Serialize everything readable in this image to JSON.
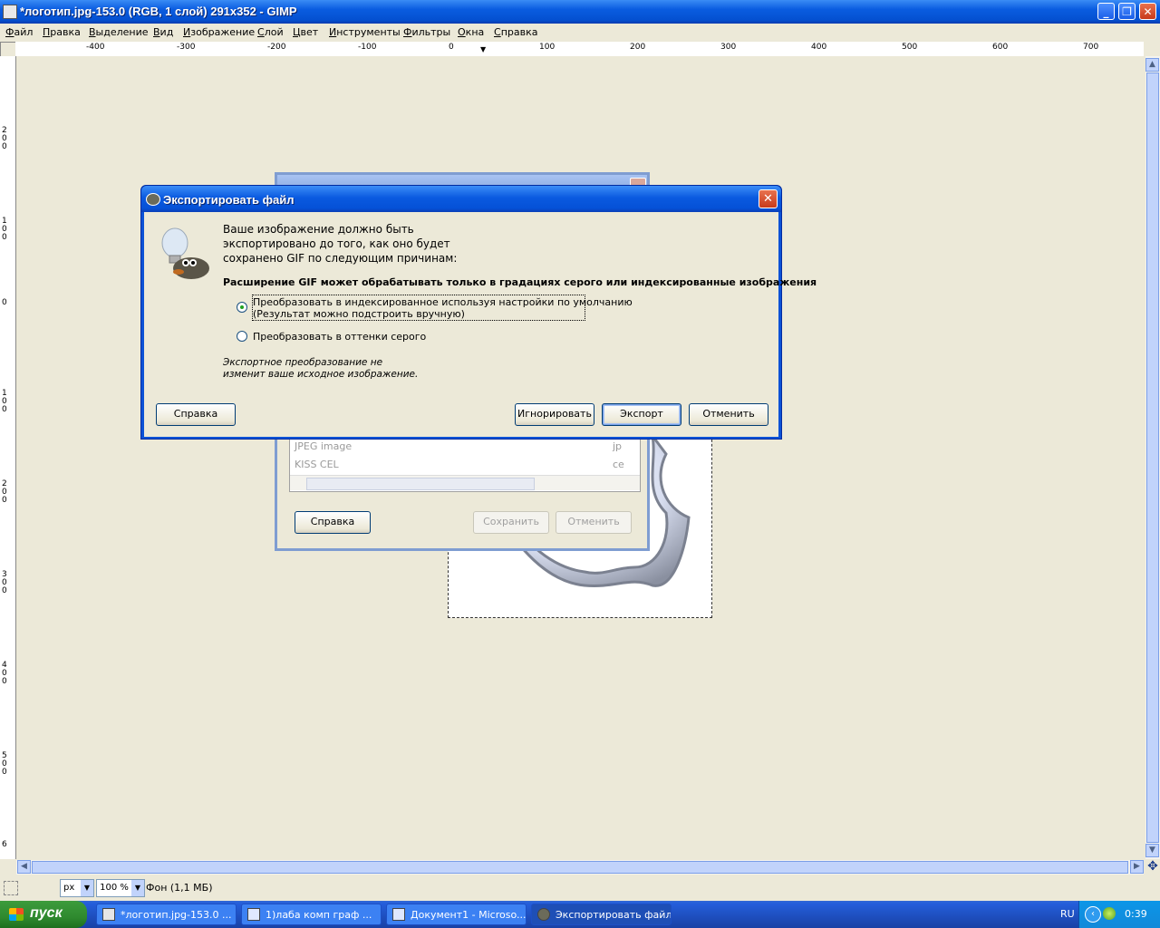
{
  "window": {
    "title": "*логотип.jpg-153.0 (RGB, 1 слой) 291x352 - GIMP",
    "buttons": {
      "minimize": "_",
      "maximize": "❐",
      "close": "✕"
    }
  },
  "menu": [
    "Файл",
    "Правка",
    "Выделение",
    "Вид",
    "Изображение",
    "Слой",
    "Цвет",
    "Инструменты",
    "Фильтры",
    "Окна",
    "Справка"
  ],
  "ruler": {
    "top_labels": [
      "-400",
      "-300",
      "-200",
      "-100",
      "0",
      "100",
      "200",
      "300",
      "400",
      "500",
      "600",
      "700"
    ],
    "left_labels": [
      "200",
      "100",
      "0",
      "100",
      "200",
      "300",
      "400",
      "500",
      "6"
    ]
  },
  "status": {
    "unit": "px",
    "zoom": "100 %",
    "layer_info": "Фон (1,1 МБ)"
  },
  "save_dialog": {
    "list_items": [
      {
        "name": "JPEG image",
        "ext": "jp"
      },
      {
        "name": "KISS CEL",
        "ext": "ce"
      }
    ],
    "help_label": "Справка",
    "save_label": "Сохранить",
    "cancel_label": "Отменить"
  },
  "export_dialog": {
    "title": "Экспортировать файл",
    "message_lines": [
      "Ваше изображение должно быть",
      "экспортировано до того, как оно будет",
      "сохранено GIF по следующим причинам:"
    ],
    "reason": "Расширение GIF может обрабатывать только в градациях серого или индексированные изображения",
    "option1_line1": "Преобразовать в индексированное используя настройки по умолчанию",
    "option1_line2": "(Результат можно подстроить вручную)",
    "option2": "Преобразовать в оттенки серого",
    "note_line1": "Экспортное преобразование не",
    "note_line2": "изменит ваше исходное изображение.",
    "help_label": "Справка",
    "ignore_label": "Игнорировать",
    "export_label": "Экспорт",
    "cancel_label": "Отменить",
    "selected_option": 1
  },
  "taskbar": {
    "start_label": "пуск",
    "tasks": [
      {
        "label": "*логотип.jpg-153.0 ...",
        "active": false
      },
      {
        "label": "1)лаба комп граф ...",
        "active": false
      },
      {
        "label": "Документ1 - Microso...",
        "active": false
      },
      {
        "label": "Экспортировать файл",
        "active": true
      }
    ],
    "lang": "RU",
    "clock": "0:39"
  }
}
